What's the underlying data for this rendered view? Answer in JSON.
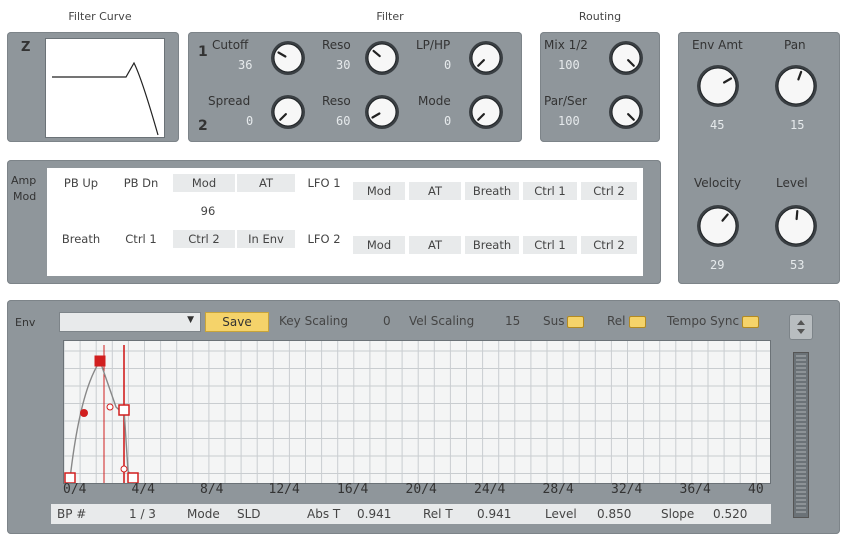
{
  "titles": {
    "filter_curve": "Filter Curve",
    "filter": "Filter",
    "routing": "Routing"
  },
  "curve_panel": {
    "z_label": "Z"
  },
  "filter": {
    "row1_index": "1",
    "row2_index": "2",
    "cutoff": {
      "label": "Cutoff",
      "value": "36"
    },
    "reso1": {
      "label": "Reso",
      "value": "30"
    },
    "lphp": {
      "label": "LP/HP",
      "value": "0"
    },
    "spread": {
      "label": "Spread",
      "value": "0"
    },
    "reso2": {
      "label": "Reso",
      "value": "60"
    },
    "mode": {
      "label": "Mode",
      "value": "0"
    }
  },
  "routing": {
    "mix": {
      "label": "Mix 1/2",
      "value": "100"
    },
    "parser": {
      "label": "Par/Ser",
      "value": "100"
    }
  },
  "right_panel": {
    "env_amt": {
      "label": "Env Amt",
      "value": "45"
    },
    "pan": {
      "label": "Pan",
      "value": "15"
    },
    "velocity": {
      "label": "Velocity",
      "value": "29"
    },
    "level": {
      "label": "Level",
      "value": "53"
    }
  },
  "amp_mod": {
    "label_line1": "Amp",
    "label_line2": "Mod",
    "row1_sources": [
      "PB Up",
      "PB Dn",
      "Mod",
      "AT",
      "LFO 1"
    ],
    "row1_value": "96",
    "row1_dest": [
      "Mod",
      "AT",
      "Breath",
      "Ctrl 1",
      "Ctrl 2"
    ],
    "row2_sources": [
      "Breath",
      "Ctrl 1",
      "Ctrl 2",
      "In Env",
      "LFO 2"
    ],
    "row2_dest": [
      "Mod",
      "AT",
      "Breath",
      "Ctrl 1",
      "Ctrl 2"
    ]
  },
  "env": {
    "label": "Env",
    "preset_value": "",
    "dropdown_arrow": "▼",
    "save_label": "Save",
    "key_scaling_label": "Key Scaling",
    "key_scaling_value": "0",
    "vel_scaling_label": "Vel Scaling",
    "vel_scaling_value": "15",
    "sus_label": "Sus",
    "rel_label": "Rel",
    "tempo_sync_label": "Tempo Sync",
    "x_ticks": [
      "0/4",
      "4/4",
      "8/4",
      "12/4",
      "16/4",
      "20/4",
      "24/4",
      "28/4",
      "32/4",
      "36/4",
      "40"
    ],
    "status": {
      "bp_label": "BP #",
      "bp_value": "1 / 3",
      "mode_label": "Mode",
      "mode_value": "SLD",
      "abst_label": "Abs T",
      "abst_value": "0.941",
      "relt_label": "Rel T",
      "relt_value": "0.941",
      "level_label": "Level",
      "level_value": "0.850",
      "slope_label": "Slope",
      "slope_value": "0.520"
    }
  },
  "colors": {
    "panel": "#8f969b",
    "envelope": "#d11f1f",
    "grid_bg": "#f4f5f5",
    "highlight": "#f5d36a"
  }
}
